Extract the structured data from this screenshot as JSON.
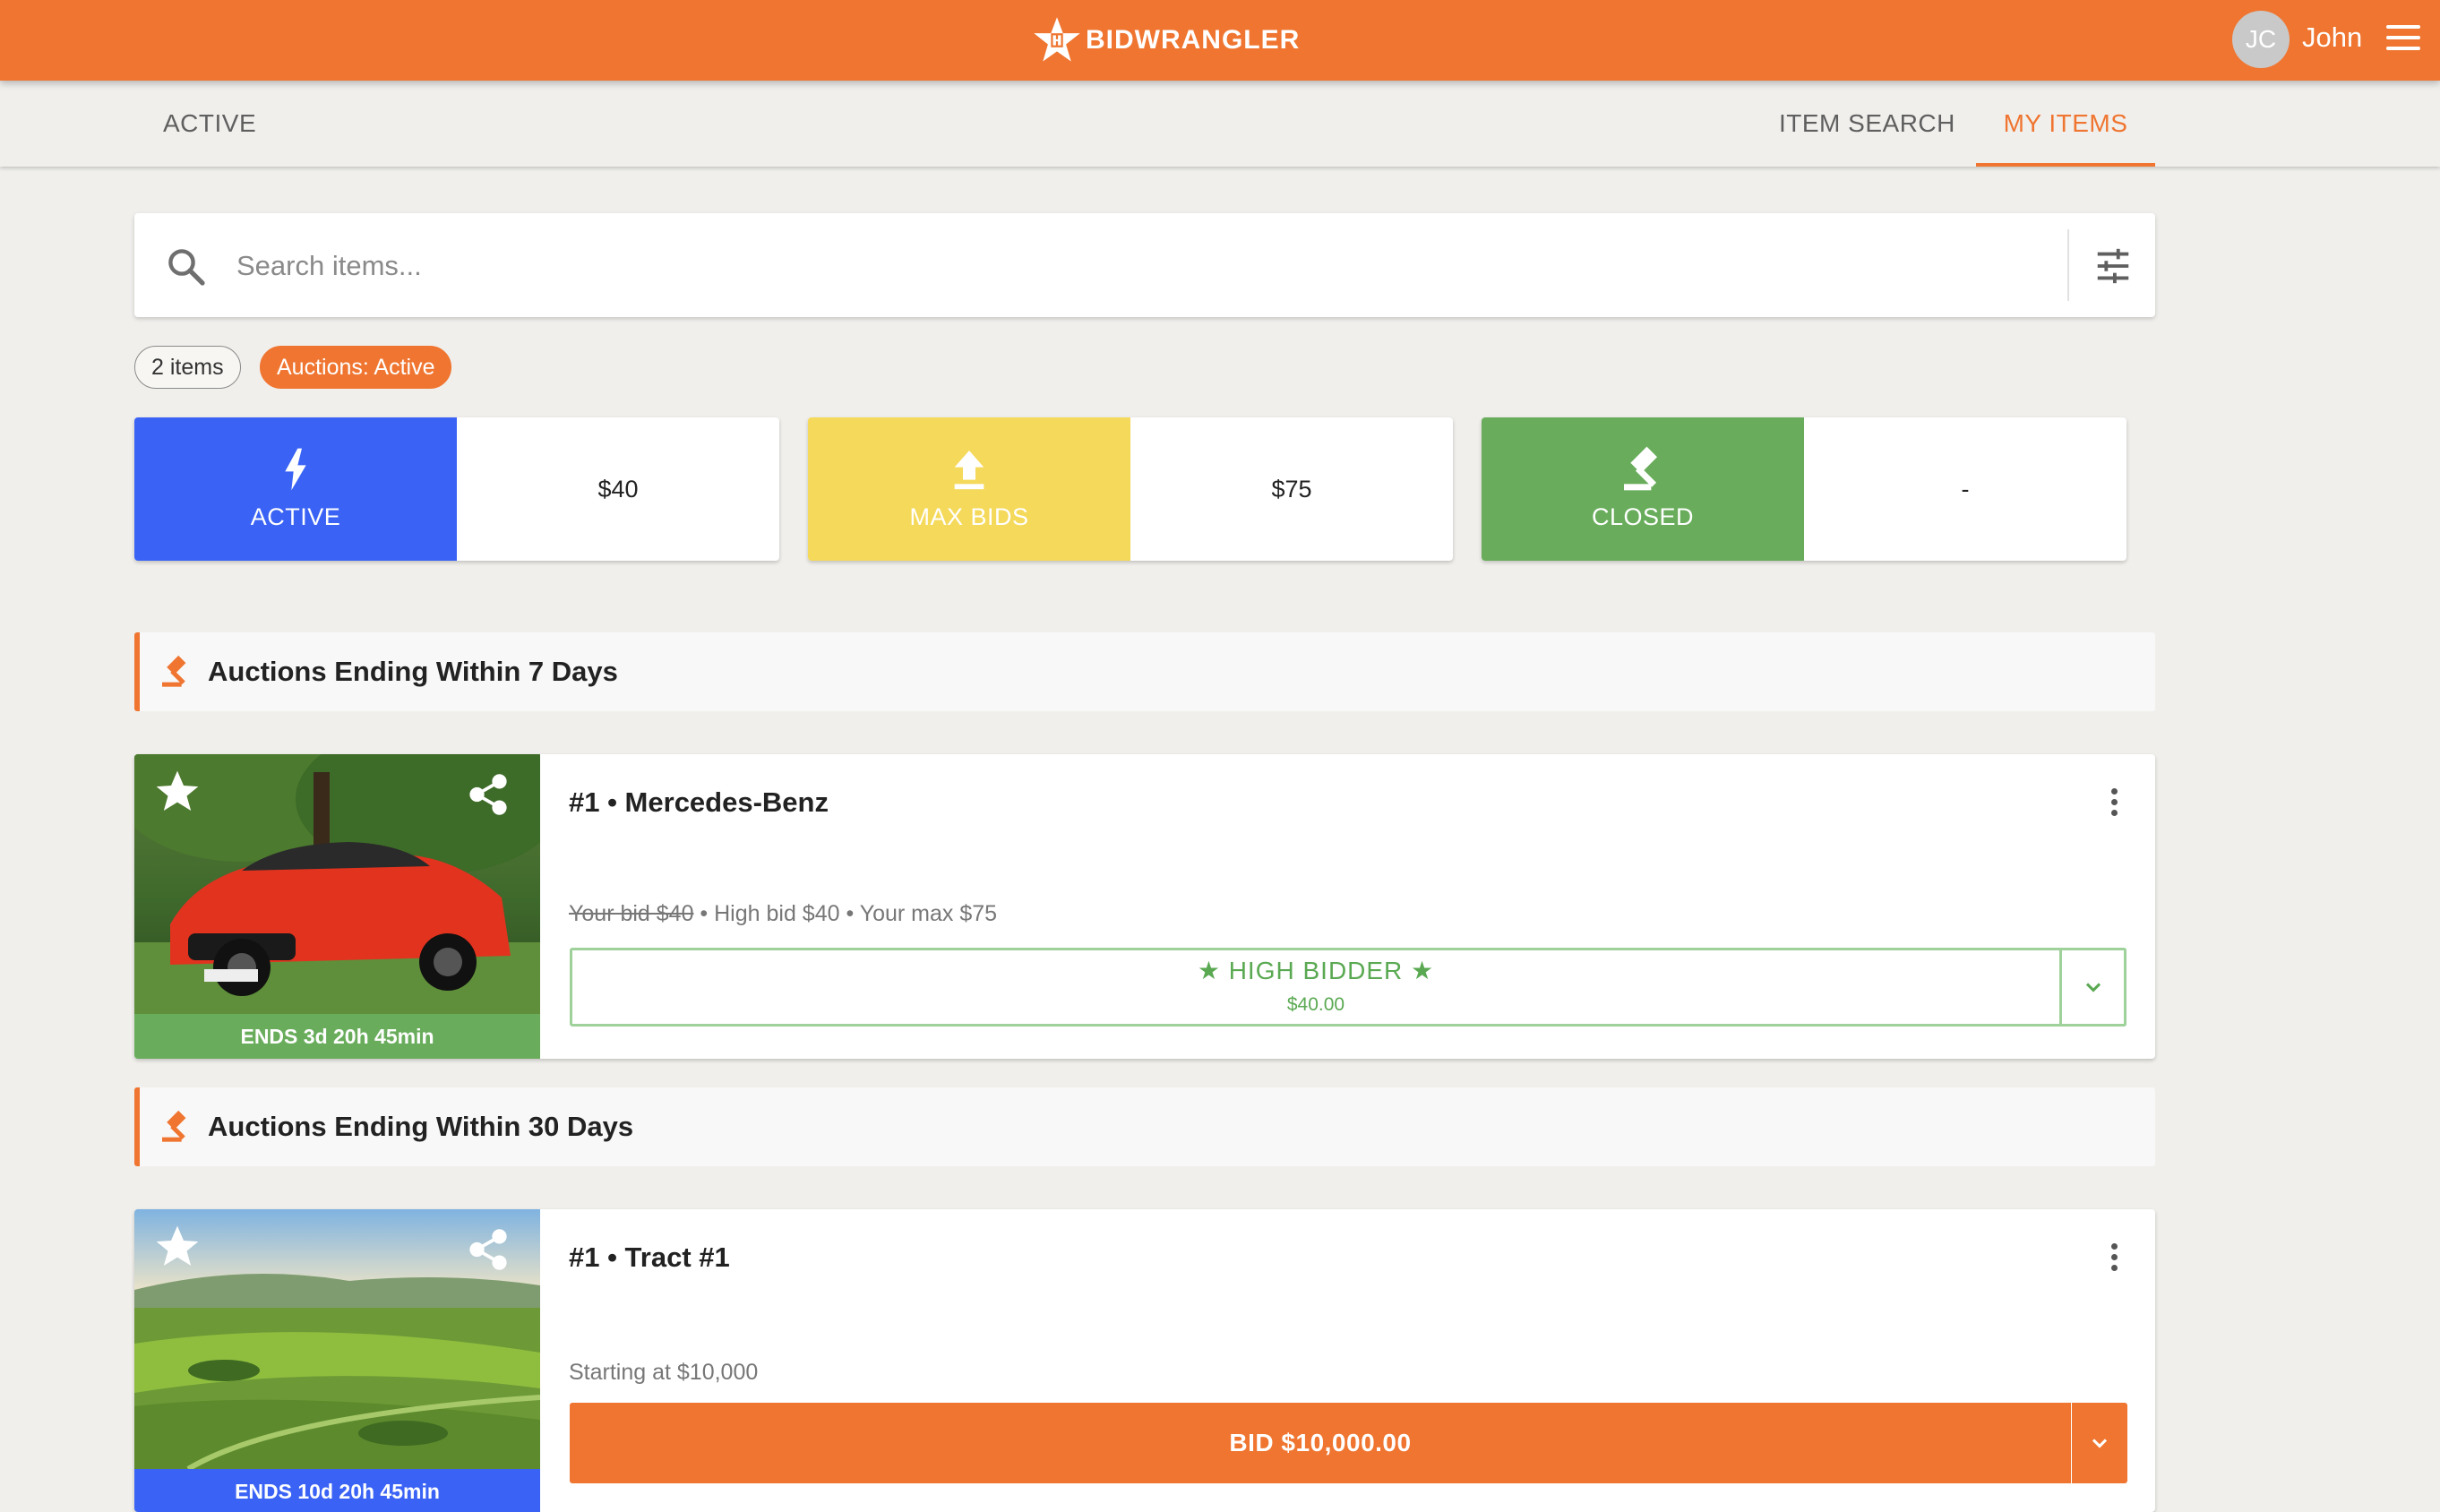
{
  "app": {
    "logo_text": "BIDWRANGLER",
    "user_initials": "JC",
    "user_name": "John"
  },
  "nav": {
    "left_tab": "ACTIVE",
    "item_search": "ITEM SEARCH",
    "my_items": "MY ITEMS"
  },
  "search": {
    "placeholder": "Search items...",
    "value": ""
  },
  "chips": {
    "count": "2 items",
    "status": "Auctions: Active"
  },
  "stats": [
    {
      "label": "ACTIVE",
      "value": "$40",
      "color": "#3a63f5",
      "icon": "lightning-icon"
    },
    {
      "label": "MAX BIDS",
      "value": "$75",
      "color": "#f5d95a",
      "icon": "upload-arrow-icon"
    },
    {
      "label": "CLOSED",
      "value": "-",
      "color": "#69ad5c",
      "icon": "gavel-icon"
    }
  ],
  "sections": [
    {
      "title": "Auctions Ending Within 7 Days",
      "item": {
        "title": "#1 • Mercedes-Benz",
        "ends": "ENDS 3d 20h 45min",
        "ends_color": "#69ad5c",
        "your_bid": "Your bid $40",
        "bid_details": " • High bid $40 • Your max $75",
        "status": "★ HIGH BIDDER ★",
        "status_amount": "$40.00"
      }
    },
    {
      "title": "Auctions Ending Within 30 Days",
      "item": {
        "title": "#1 • Tract #1",
        "ends": "ENDS 10d 20h 45min",
        "ends_color": "#3a63f5",
        "starting": "Starting at $10,000",
        "bid_button": "BID $10,000.00"
      }
    }
  ],
  "colors": {
    "brand": "#ef7530",
    "success": "#5aa952",
    "background": "#f0efec"
  }
}
